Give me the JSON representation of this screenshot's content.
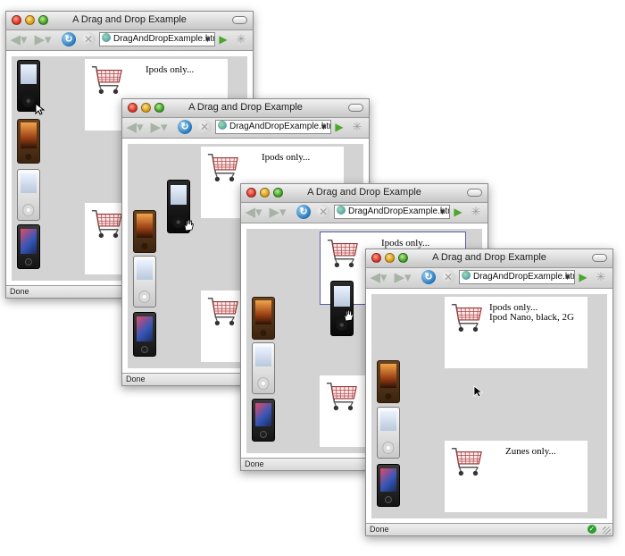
{
  "windows": [
    {
      "title": "A Drag and Drop Example",
      "url": "DragAndDropExample.html",
      "status": "Done",
      "drop_zone_top": {
        "text": "Ipods only...",
        "text2": ""
      },
      "drop_zone_bottom": {
        "text": ""
      }
    },
    {
      "title": "A Drag and Drop Example",
      "url": "DragAndDropExample.html",
      "status": "Done",
      "drop_zone_top": {
        "text": "Ipods only...",
        "text2": ""
      },
      "drop_zone_bottom": {
        "text": ""
      }
    },
    {
      "title": "A Drag and Drop Example",
      "url": "DragAndDropExample.html",
      "status": "Done",
      "drop_zone_top": {
        "text": "Ipods only...",
        "text2": ""
      },
      "drop_zone_bottom": {
        "text": ""
      }
    },
    {
      "title": "A Drag and Drop Example",
      "url": "DragAndDropExample.html",
      "status": "Done",
      "drop_zone_top": {
        "text": "Ipods only...",
        "text2": "Ipod Nano, black, 2G"
      },
      "drop_zone_bottom": {
        "text": "Zunes only..."
      }
    }
  ],
  "icons": {
    "back": "back-arrow-icon",
    "forward": "forward-arrow-icon",
    "reload": "reload-icon",
    "stop": "stop-icon",
    "go": "go-arrow-icon",
    "loading": "spinner-icon",
    "cart": "shopping-cart-icon",
    "page_loaded": "checkmark-icon"
  },
  "colors": {
    "drag_area": "#d3d3d3",
    "drop_zone": "#ffffff",
    "active_drop_border": "#5a5aa8",
    "go_button": "#4ca62c"
  }
}
